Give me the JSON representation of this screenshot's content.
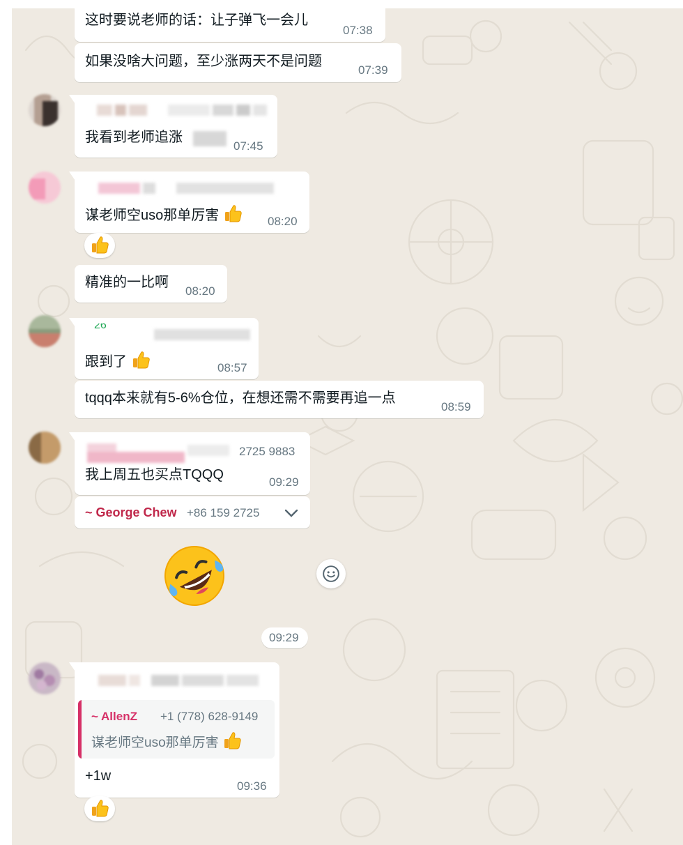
{
  "colors": {
    "chat_background": "#efeae2",
    "bubble": "#ffffff",
    "timestamp": "#667781",
    "contact_red": "#c0284b",
    "quote_bar": "#d63067"
  },
  "messages": [
    {
      "text": "这时要说老师的话：让子弹飞一会儿",
      "time": "07:38"
    },
    {
      "text": "如果没啥大问题，至少涨两天不是问题",
      "time": "07:39"
    },
    {
      "text": "我看到老师追涨",
      "time": "07:45"
    },
    {
      "text": "谋老师空uso那单厉害",
      "time": "08:20",
      "reaction_icon": "thumbs-up-emoji"
    },
    {
      "text": "精准的一比啊",
      "time": "08:20"
    },
    {
      "text": "跟到了",
      "time": "08:57"
    },
    {
      "text": "tqqq本来就有5-6%仓位，在想还需不需要再追一点",
      "time": "08:59"
    },
    {
      "text": "我上周五也买点TQQQ",
      "time": "09:29",
      "sender_phone": "2725 9883"
    },
    {
      "contact_name": "~ George Chew",
      "contact_phone": "+86 159 2725",
      "menu_icon": "chevron-down-icon"
    },
    {
      "sticker_icon": "rolling-on-floor-laughing-emoji",
      "time": "09:29",
      "react_icon": "smiley-icon"
    },
    {
      "quoted_name": "~ AllenZ",
      "quoted_phone": "+1 (778) 628-9149",
      "quoted_text": "谋老师空uso那单厉害",
      "text": "+1w",
      "time": "09:36",
      "reaction_icon": "thumbs-up-emoji"
    }
  ],
  "reply_marker": "26"
}
